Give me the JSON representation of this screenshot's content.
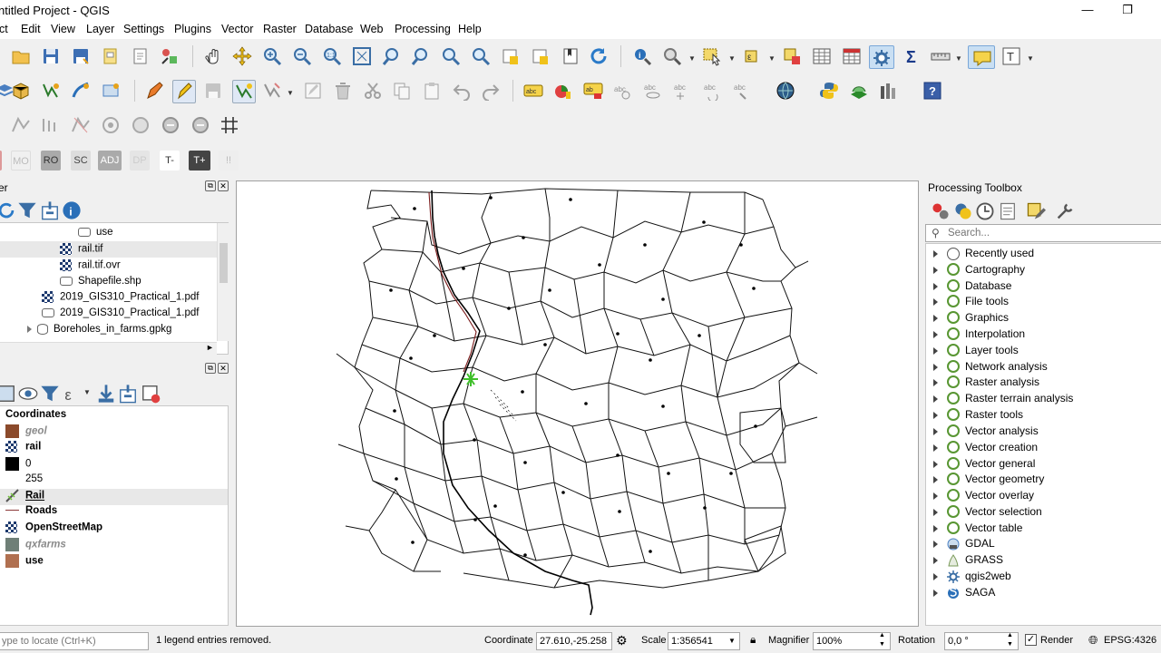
{
  "window": {
    "title": "ntitled Project - QGIS",
    "minimize": "—",
    "restore": "❐"
  },
  "menu": [
    "ct",
    "Edit",
    "View",
    "Layer",
    "Settings",
    "Plugins",
    "Vector",
    "Raster",
    "Database",
    "Web",
    "Processing",
    "Help"
  ],
  "label_toolbar": {
    "buttons": [
      "MO",
      "RO",
      "SC",
      "ADJ",
      "DP",
      "T-",
      "T+",
      "!!"
    ]
  },
  "browser": {
    "title": "er",
    "items": [
      {
        "label": "use"
      },
      {
        "label": "rail.tif"
      },
      {
        "label": "rail.tif.ovr"
      },
      {
        "label": "Shapefile.shp"
      },
      {
        "label": "2019_GIS310_Practical_1.pdf"
      },
      {
        "label": "2019_GIS310_Practical_1.pdf"
      },
      {
        "label": "Boreholes_in_farms.gpkg"
      }
    ]
  },
  "layers": {
    "items": [
      {
        "label": "Coordinates",
        "style": "bold"
      },
      {
        "label": "geol",
        "style": "italic-gray",
        "color": "#8b4a2b"
      },
      {
        "label": "rail",
        "style": "bold"
      },
      {
        "label": "0",
        "style": "normal",
        "color": "#000000"
      },
      {
        "label": "255",
        "style": "normal"
      },
      {
        "label": "Rail",
        "style": "bold-underline"
      },
      {
        "label": "Roads",
        "style": "bold",
        "color": "#8b3a3a"
      },
      {
        "label": "OpenStreetMap",
        "style": "bold"
      },
      {
        "label": "qxfarms",
        "style": "italic-gray",
        "color": "#6f7f77"
      },
      {
        "label": "use",
        "style": "bold",
        "color": "#b07050"
      }
    ]
  },
  "processing": {
    "title": "Processing Toolbox",
    "search_placeholder": "Search...",
    "items": [
      {
        "label": "Recently used",
        "icon": "clock-icon"
      },
      {
        "label": "Cartography",
        "icon": "qgis-icon"
      },
      {
        "label": "Database",
        "icon": "qgis-icon"
      },
      {
        "label": "File tools",
        "icon": "qgis-icon"
      },
      {
        "label": "Graphics",
        "icon": "qgis-icon"
      },
      {
        "label": "Interpolation",
        "icon": "qgis-icon"
      },
      {
        "label": "Layer tools",
        "icon": "qgis-icon"
      },
      {
        "label": "Network analysis",
        "icon": "qgis-icon"
      },
      {
        "label": "Raster analysis",
        "icon": "qgis-icon"
      },
      {
        "label": "Raster terrain analysis",
        "icon": "qgis-icon"
      },
      {
        "label": "Raster tools",
        "icon": "qgis-icon"
      },
      {
        "label": "Vector analysis",
        "icon": "qgis-icon"
      },
      {
        "label": "Vector creation",
        "icon": "qgis-icon"
      },
      {
        "label": "Vector general",
        "icon": "qgis-icon"
      },
      {
        "label": "Vector geometry",
        "icon": "qgis-icon"
      },
      {
        "label": "Vector overlay",
        "icon": "qgis-icon"
      },
      {
        "label": "Vector selection",
        "icon": "qgis-icon"
      },
      {
        "label": "Vector table",
        "icon": "qgis-icon"
      },
      {
        "label": "GDAL",
        "icon": "gdal-icon"
      },
      {
        "label": "GRASS",
        "icon": "grass-icon"
      },
      {
        "label": "qgis2web",
        "icon": "gear-icon"
      },
      {
        "label": "SAGA",
        "icon": "saga-icon"
      }
    ]
  },
  "status": {
    "locate_placeholder": "ype to locate (Ctrl+K)",
    "message": "1 legend entries removed.",
    "coordinate_label": "Coordinate",
    "coordinate_value": "27.610,-25.258",
    "scale_label": "Scale",
    "scale_value": "1:356541",
    "magnifier_label": "Magnifier",
    "magnifier_value": "100%",
    "rotation_label": "Rotation",
    "rotation_value": "0,0 °",
    "render_label": "Render",
    "crs": "EPSG:4326"
  }
}
